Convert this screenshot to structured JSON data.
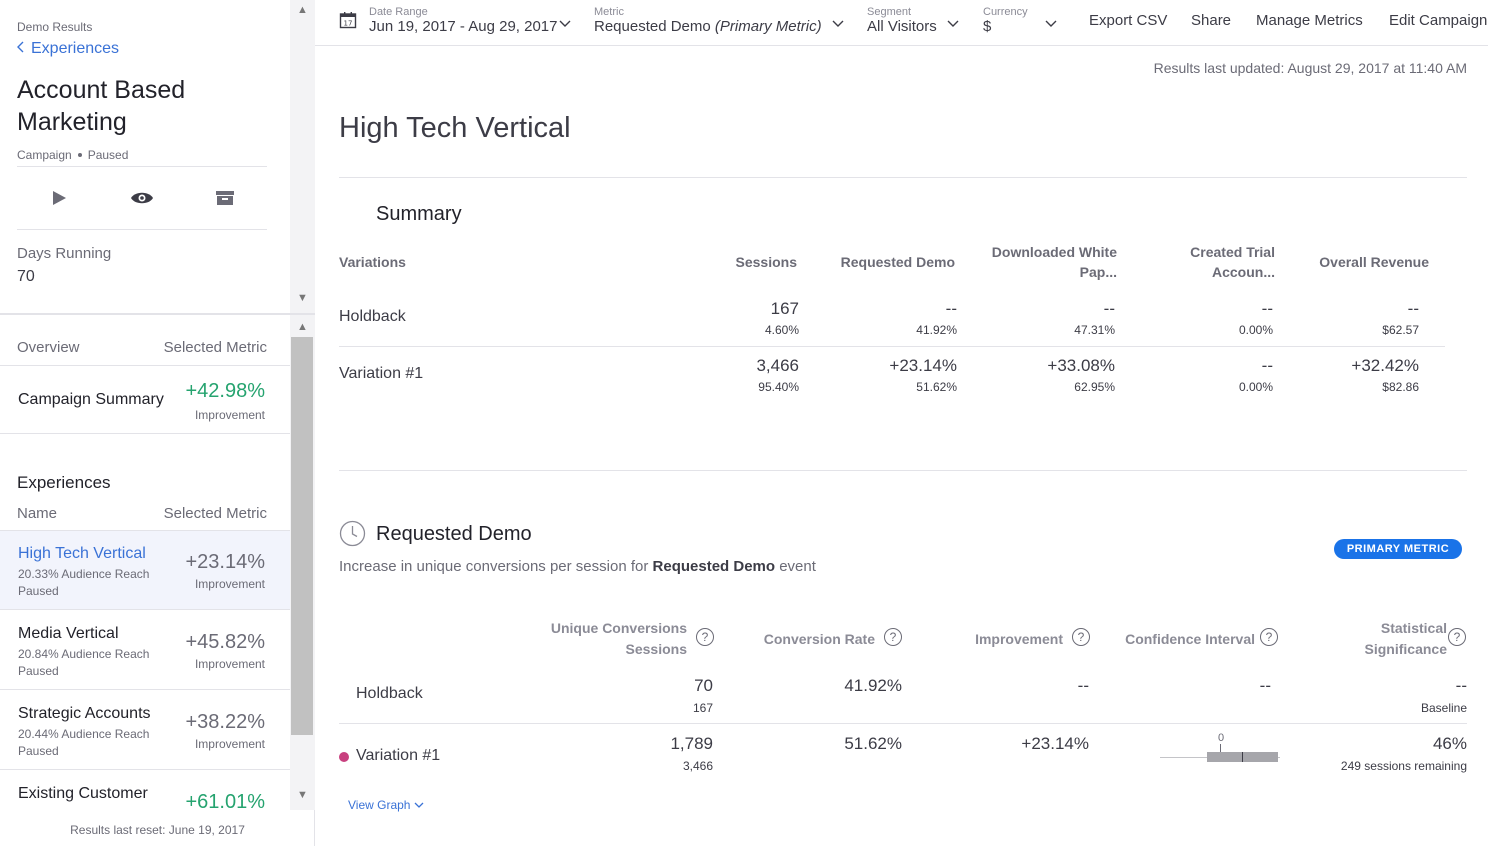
{
  "sidebar": {
    "breadcrumb": "Demo Results",
    "back_label": "Experiences",
    "campaign_title": "Account Based Marketing",
    "campaign_type": "Campaign",
    "campaign_status": "Paused",
    "days_running_label": "Days Running",
    "days_running_value": "70",
    "overview_label": "Overview",
    "selected_metric_label": "Selected Metric",
    "campaign_summary": {
      "label": "Campaign Summary",
      "value": "+42.98%",
      "sub": "Improvement"
    },
    "experiences_title": "Experiences",
    "name_label": "Name",
    "experiences": [
      {
        "name": "High Tech Vertical",
        "reach": "20.33% Audience Reach",
        "state": "Paused",
        "value": "+23.14%",
        "sub": "Improvement"
      },
      {
        "name": "Media Vertical",
        "reach": "20.84% Audience Reach",
        "state": "Paused",
        "value": "+45.82%",
        "sub": "Improvement"
      },
      {
        "name": "Strategic Accounts",
        "reach": "20.44% Audience Reach",
        "state": "Paused",
        "value": "+38.22%",
        "sub": "Improvement"
      },
      {
        "name": "Existing Customer",
        "reach": "",
        "state": "",
        "value": "+61.01%",
        "sub": ""
      }
    ],
    "footer": "Results last reset: June 19, 2017"
  },
  "topbar": {
    "date_range": {
      "label": "Date Range",
      "value": "Jun 19, 2017 - Aug 29, 2017"
    },
    "metric": {
      "label": "Metric",
      "value": "Requested Demo",
      "suffix": "(Primary Metric)"
    },
    "segment": {
      "label": "Segment",
      "value": "All Visitors"
    },
    "currency": {
      "label": "Currency",
      "value": "$"
    },
    "links": [
      "Export CSV",
      "Share",
      "Manage Metrics",
      "Edit Campaign"
    ]
  },
  "main": {
    "updated": "Results last updated: August 29, 2017 at 11:40 AM",
    "experience_title": "High Tech Vertical",
    "summary": {
      "title": "Summary",
      "headers": [
        "Variations",
        "Sessions",
        "Requested Demo",
        "Downloaded White Pap...",
        "Created Trial Accoun...",
        "Overall Revenue"
      ],
      "rows": [
        {
          "name": "Holdback",
          "cells": [
            {
              "main": "167",
              "sub": "4.60%"
            },
            {
              "main": "--",
              "sub": "41.92%"
            },
            {
              "main": "--",
              "sub": "47.31%"
            },
            {
              "main": "--",
              "sub": "0.00%"
            },
            {
              "main": "--",
              "sub": "$62.57"
            }
          ]
        },
        {
          "name": "Variation #1",
          "cells": [
            {
              "main": "3,466",
              "sub": "95.40%"
            },
            {
              "main": "+23.14%",
              "sub": "51.62%"
            },
            {
              "main": "+33.08%",
              "sub": "62.95%"
            },
            {
              "main": "--",
              "sub": "0.00%"
            },
            {
              "main": "+32.42%",
              "sub": "$82.86"
            }
          ]
        }
      ]
    },
    "requested_demo": {
      "title": "Requested Demo",
      "desc_prefix": "Increase in unique conversions per session for",
      "desc_metric": "Requested Demo",
      "desc_suffix": "event",
      "badge": "PRIMARY METRIC",
      "headers": {
        "unique_conversions": "Unique Conversions",
        "sessions": "Sessions",
        "conversion_rate": "Conversion Rate",
        "improvement": "Improvement",
        "confidence_interval": "Confidence Interval",
        "stat_sig_1": "Statistical",
        "stat_sig_2": "Significance"
      },
      "help_glyph": "?",
      "rows": [
        {
          "name": "Holdback",
          "conversions": "70",
          "sessions": "167",
          "rate": "41.92%",
          "improvement": "--",
          "ci": "--",
          "sig": "--",
          "sig_sub": "Baseline"
        },
        {
          "name": "Variation #1",
          "conversions": "1,789",
          "sessions": "3,466",
          "rate": "51.62%",
          "improvement": "+23.14%",
          "ci_zero": "0",
          "sig": "46%",
          "sig_sub": "249 sessions remaining"
        }
      ],
      "view_graph": "View Graph"
    }
  },
  "colors": {
    "accent_blue": "#3a72d6",
    "positive_green": "#25a36f",
    "badge_blue": "#1a73e8",
    "variation_dot": "#c8407f"
  }
}
